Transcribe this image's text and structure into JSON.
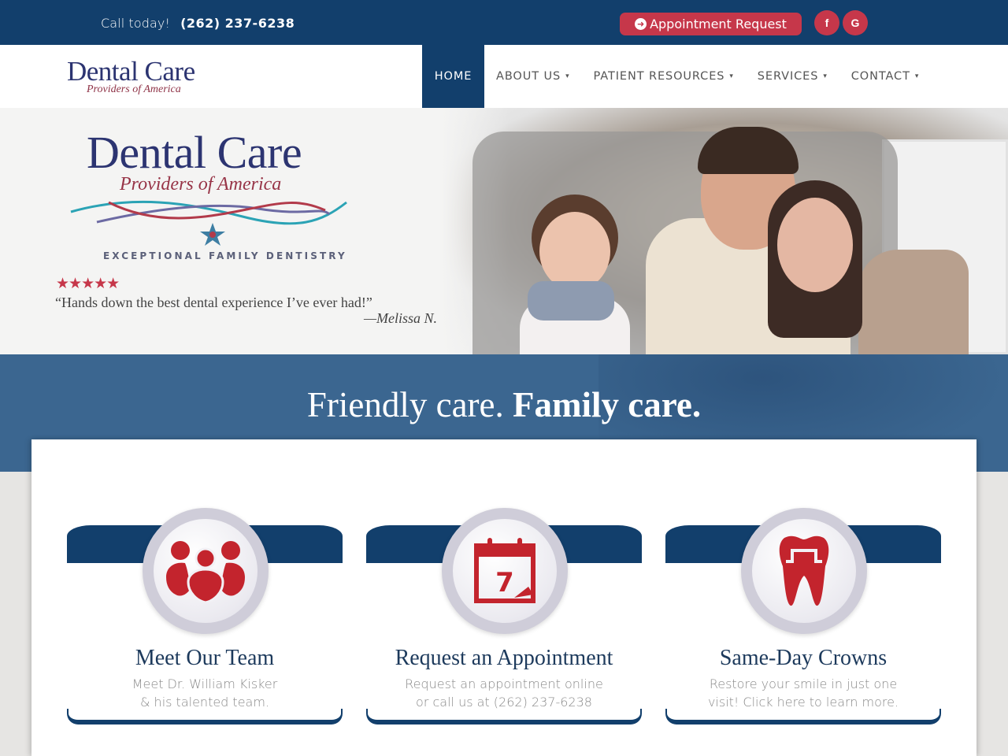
{
  "topbar": {
    "call_label": "Call today!",
    "phone": "(262) 237-6238",
    "appointment_button": "Appointment Request",
    "social": [
      {
        "name": "facebook",
        "glyph": "f"
      },
      {
        "name": "google",
        "glyph": "G"
      }
    ]
  },
  "nav": {
    "logo_title": "Dental Care",
    "logo_subtitle": "Providers of America",
    "items": [
      {
        "label": "HOME",
        "active": true,
        "dropdown": false
      },
      {
        "label": "ABOUT US",
        "active": false,
        "dropdown": true
      },
      {
        "label": "PATIENT RESOURCES",
        "active": false,
        "dropdown": true
      },
      {
        "label": "SERVICES",
        "active": false,
        "dropdown": true
      },
      {
        "label": "CONTACT",
        "active": false,
        "dropdown": true
      }
    ],
    "chevron": "⌄"
  },
  "hero": {
    "logo_title": "Dental Care",
    "logo_subtitle": "Providers of America",
    "tagline": "EXCEPTIONAL FAMILY DENTISTRY",
    "rating": 5,
    "stars": "★★★★★",
    "quote": "“Hands down the best dental experience I’ve ever had!”",
    "author": "—Melissa N."
  },
  "slogan": {
    "light": "Friendly care.",
    "bold": "Family care."
  },
  "features": [
    {
      "icon": "team-icon",
      "title": "Meet Our Team",
      "line1": "Meet Dr. William Kisker",
      "line2": "& his talented team."
    },
    {
      "icon": "calendar-icon",
      "title": "Request an Appointment",
      "line1": "Request an appointment online",
      "line2": "or call us at (262) 237-6238",
      "calendar_day": "7"
    },
    {
      "icon": "tooth-crown-icon",
      "title": "Same-Day Crowns",
      "line1": "Restore your smile in just one",
      "line2": "visit! Click here to learn more."
    }
  ],
  "colors": {
    "navy": "#123f6c",
    "red": "#c6374a",
    "logo_blue": "#2c3471",
    "logo_red": "#973447"
  }
}
